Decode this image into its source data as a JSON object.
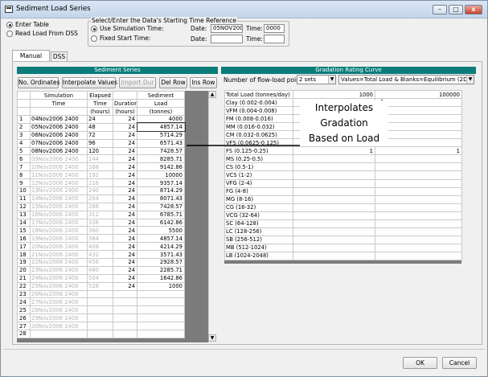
{
  "window": {
    "title": "Sediment Load Series",
    "buttons": {
      "minimize": "–",
      "maximize": "□",
      "close": "x"
    }
  },
  "source": {
    "enter_table": "Enter Table",
    "read_dss": "Read Load From DSS",
    "selected": "enter_table"
  },
  "reference": {
    "group_title": "Select/Enter the Data's Starting Time Reference",
    "use_sim_label": "Use Simulation Time:",
    "fixed_label": "Fixed Start Time:",
    "date_label": "Date:",
    "time_label": "Time:",
    "date1": "05NOV2006",
    "time1": "0000",
    "date2": "",
    "time2": "",
    "selected": "use_sim"
  },
  "tabs": [
    "Manual Entry",
    "DSS"
  ],
  "sediment": {
    "header": "Sediment Series",
    "buttons": [
      "No. Ordinates",
      "Interpolate Values",
      "Import Dur",
      "Del Row",
      "Ins Row"
    ],
    "columns": [
      [
        "",
        "Simulation",
        "Elapsed",
        "",
        "Sediment"
      ],
      [
        "",
        "Time",
        "Time",
        "Duration",
        "Load"
      ],
      [
        "",
        "",
        "(hours)",
        "(hours)",
        "(tonnes)"
      ]
    ],
    "rows": [
      [
        "1",
        "04Nov2006 2400",
        "24",
        "24",
        "4000"
      ],
      [
        "2",
        "05Nov2006 2400",
        "48",
        "24",
        "4857.14"
      ],
      [
        "3",
        "06Nov2006 2400",
        "72",
        "24",
        "5714.29"
      ],
      [
        "4",
        "07Nov2006 2400",
        "96",
        "24",
        "6571.43"
      ],
      [
        "5",
        "08Nov2006 2400",
        "120",
        "24",
        "7428.57"
      ],
      [
        "6",
        "09Nov2006 2400",
        "144",
        "24",
        "8285.71"
      ],
      [
        "7",
        "10Nov2006 2400",
        "168",
        "24",
        "9142.86"
      ],
      [
        "8",
        "11Nov2006 2400",
        "192",
        "24",
        "10000"
      ],
      [
        "9",
        "12Nov2006 2400",
        "216",
        "24",
        "9357.14"
      ],
      [
        "10",
        "13Nov2006 2400",
        "240",
        "24",
        "8714.29"
      ],
      [
        "11",
        "14Nov2006 2400",
        "264",
        "24",
        "8071.43"
      ],
      [
        "12",
        "15Nov2006 2400",
        "288",
        "24",
        "7428.57"
      ],
      [
        "13",
        "16Nov2006 2400",
        "312",
        "24",
        "6785.71"
      ],
      [
        "14",
        "17Nov2006 2400",
        "336",
        "24",
        "6142.86"
      ],
      [
        "15",
        "18Nov2006 2400",
        "360",
        "24",
        "5500"
      ],
      [
        "16",
        "19Nov2006 2400",
        "384",
        "24",
        "4857.14"
      ],
      [
        "17",
        "20Nov2006 2400",
        "408",
        "24",
        "4214.29"
      ],
      [
        "18",
        "21Nov2006 2400",
        "432",
        "24",
        "3571.43"
      ],
      [
        "19",
        "22Nov2006 2400",
        "456",
        "24",
        "2928.57"
      ],
      [
        "20",
        "23Nov2006 2400",
        "480",
        "24",
        "2285.71"
      ],
      [
        "21",
        "24Nov2006 2400",
        "504",
        "24",
        "1642.86"
      ],
      [
        "22",
        "25Nov2006 2400",
        "528",
        "24",
        "1000"
      ],
      [
        "23",
        "26Nov2006 2400",
        "",
        "",
        ""
      ],
      [
        "24",
        "27Nov2006 2400",
        "",
        "",
        ""
      ],
      [
        "25",
        "28Nov2006 2400",
        "",
        "",
        ""
      ],
      [
        "26",
        "29Nov2006 2400",
        "",
        "",
        ""
      ],
      [
        "27",
        "30Nov2006 2400",
        "",
        "",
        ""
      ],
      [
        "28",
        "",
        "",
        "",
        ""
      ]
    ],
    "gray_from_row": 6
  },
  "gradation": {
    "header": "Gradation Rating Curve",
    "points_label": "Number of flow-load points",
    "points_value": "2 sets",
    "mode_value": "Values=Total Load & Blanks=Equilibrium (2D Only)",
    "rows": [
      [
        "Total Load (tonnes/day)",
        "1000",
        "100000"
      ],
      [
        "Clay (0.002-0.004)",
        "",
        ""
      ],
      [
        "VFM (0.004-0.008)",
        "",
        ""
      ],
      [
        "FM (0.008-0.016)",
        "",
        ""
      ],
      [
        "MM (0.016-0.032)",
        "",
        ""
      ],
      [
        "CM (0.032-0.0625)",
        "",
        ""
      ],
      [
        "VFS (0.0625-0.125)",
        "",
        ""
      ],
      [
        "FS (0.125-0.25)",
        "1",
        "1"
      ],
      [
        "MS (0.25-0.5)",
        "",
        ""
      ],
      [
        "CS (0.5-1)",
        "",
        ""
      ],
      [
        "VCS (1-2)",
        "",
        ""
      ],
      [
        "VFG (2-4)",
        "",
        ""
      ],
      [
        "FG (4-8)",
        "",
        ""
      ],
      [
        "MG (8-16)",
        "",
        ""
      ],
      [
        "CG (16-32)",
        "",
        ""
      ],
      [
        "VCG (32-64)",
        "",
        ""
      ],
      [
        "SC (64-128)",
        "",
        ""
      ],
      [
        "LC (128-256)",
        "",
        ""
      ],
      [
        "SB (256-512)",
        "",
        ""
      ],
      [
        "MB (512-1024)",
        "",
        ""
      ],
      [
        "LB (1024-2048)",
        "",
        ""
      ]
    ]
  },
  "annotation": [
    "Interpolates",
    "Gradation",
    "Based on Load"
  ],
  "footer": {
    "ok": "OK",
    "cancel": "Cancel"
  }
}
